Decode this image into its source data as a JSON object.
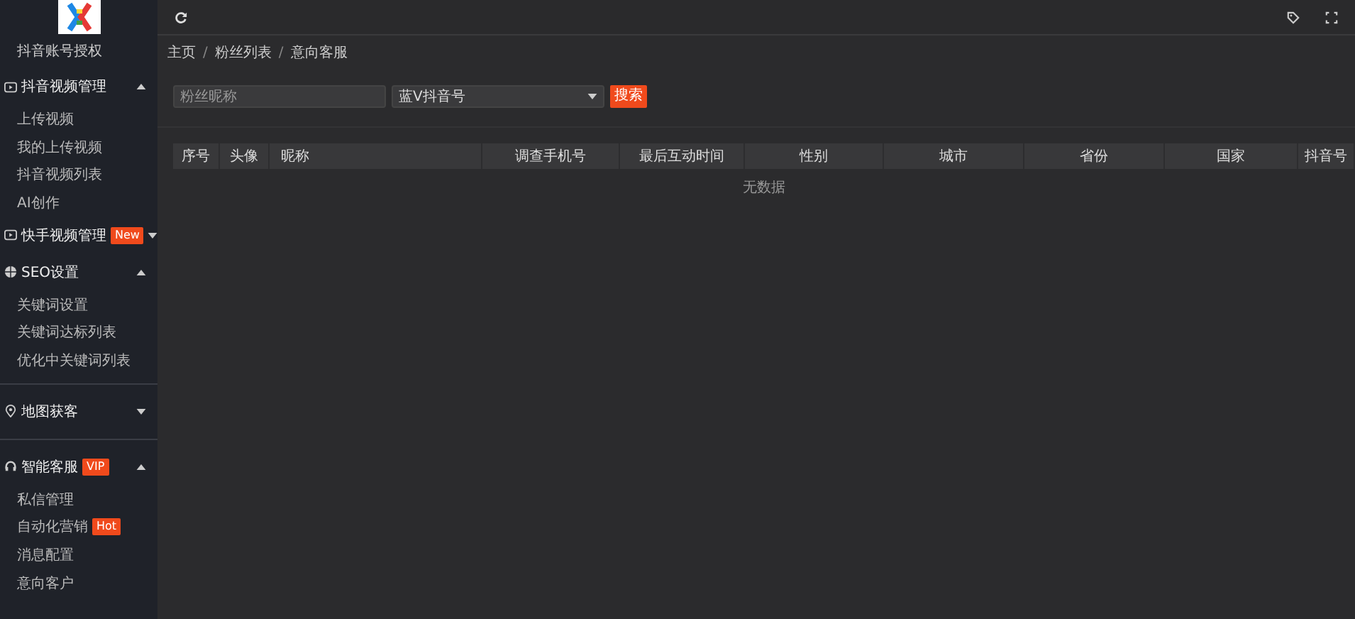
{
  "sidebar": {
    "sections": [
      {
        "items": [
          {
            "kind": "link",
            "label": "抖音账号授权"
          },
          {
            "kind": "group",
            "label": "抖音视频管理",
            "expanded": true,
            "children": [
              {
                "label": "上传视频"
              },
              {
                "label": "我的上传视频"
              },
              {
                "label": "抖音视频列表"
              },
              {
                "label": "AI创作"
              }
            ]
          },
          {
            "kind": "group",
            "label": "快手视频管理",
            "badge": "New",
            "expanded": false
          },
          {
            "kind": "group",
            "label": "SEO设置",
            "expanded": true,
            "children": [
              {
                "label": "关键词设置"
              },
              {
                "label": "关键词达标列表"
              },
              {
                "label": "优化中关键词列表"
              }
            ]
          }
        ]
      },
      {
        "items": [
          {
            "kind": "group",
            "label": "地图获客",
            "expanded": false
          }
        ]
      },
      {
        "items": [
          {
            "kind": "group",
            "label": "智能客服",
            "badge": "VIP",
            "expanded": true,
            "children": [
              {
                "label": "私信管理"
              },
              {
                "label": "自动化营销",
                "badge": "Hot"
              },
              {
                "label": "消息配置"
              },
              {
                "label": "意向客户"
              }
            ]
          }
        ]
      }
    ]
  },
  "breadcrumb": {
    "separator": "/",
    "items": [
      "主页",
      "粉丝列表",
      "意向客服"
    ]
  },
  "filters": {
    "nickname": {
      "placeholder": "粉丝昵称"
    },
    "account_select": {
      "value": "蓝V抖音号"
    },
    "search_button": "搜索"
  },
  "table": {
    "columns": [
      "序号",
      "头像",
      "昵称",
      "调查手机号",
      "最后互动时间",
      "性别",
      "城市",
      "省份",
      "国家",
      "抖音号"
    ],
    "empty_text": "无数据"
  }
}
